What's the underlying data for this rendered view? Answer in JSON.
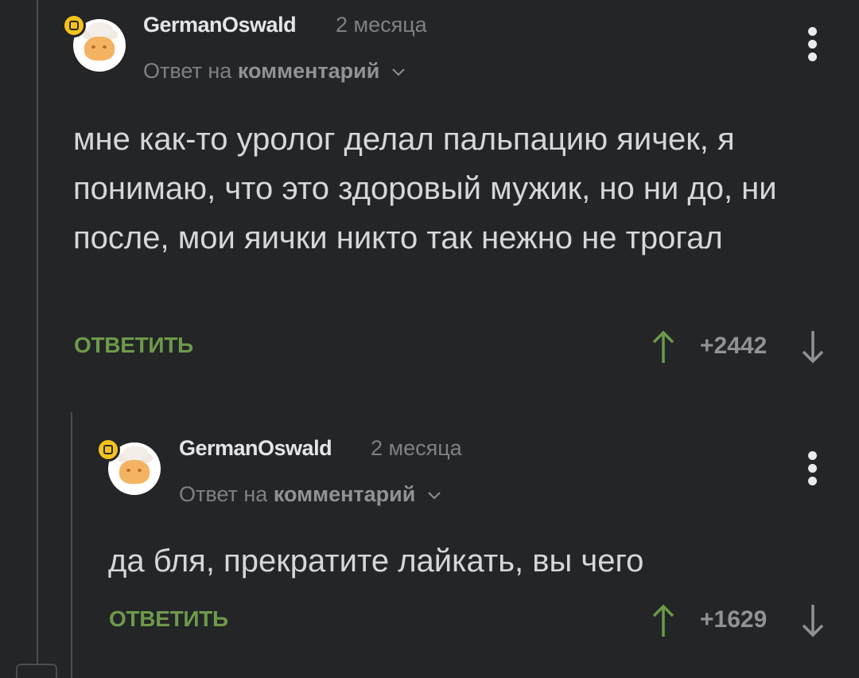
{
  "comments": [
    {
      "author": "GermanOswald",
      "time": "2 месяца",
      "reply_prefix": "Ответ на",
      "reply_link": "комментарий",
      "text": "мне как-то уролог делал пальпацию яичек, я понимаю, что это здоровый мужик, но ни до, ни после, мои яички никто так нежно не трогал",
      "reply_label": "ОТВЕТИТЬ",
      "score": "+2442"
    },
    {
      "author": "GermanOswald",
      "time": "2 месяца",
      "reply_prefix": "Ответ на",
      "reply_link": "комментарий",
      "text": "да бля, прекратите лайкать, вы чего",
      "reply_label": "ОТВЕТИТЬ",
      "score": "+1629"
    }
  ],
  "icons": {
    "more": "more-vertical-icon",
    "vote_up": "arrow-up-icon",
    "vote_down": "arrow-down-icon",
    "chevron": "chevron-down-icon",
    "badge": "badge-icon"
  },
  "colors": {
    "background": "#232527",
    "accent_green": "#6d9a4a",
    "badge_yellow": "#f5c21b",
    "muted": "#7e8285"
  }
}
